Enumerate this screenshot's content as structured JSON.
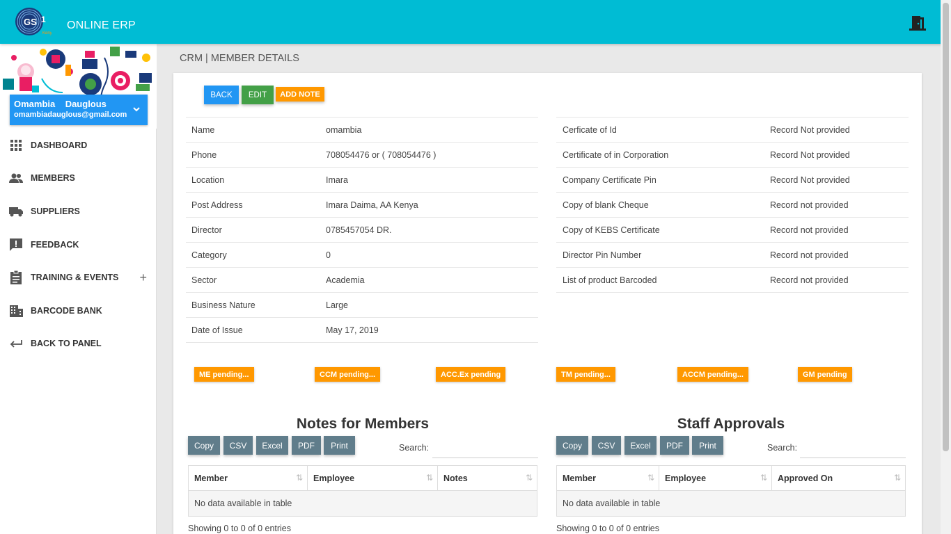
{
  "app": {
    "brand": "ONLINE ERP",
    "logo_text": "GS1",
    "logo_sub": "Kenya"
  },
  "user": {
    "name": "Omambia    Dauglous",
    "email": "omambiadauglous@gmail.com"
  },
  "sidebar": {
    "items": [
      {
        "label": "DASHBOARD",
        "icon": "grid-icon"
      },
      {
        "label": "MEMBERS",
        "icon": "people-icon"
      },
      {
        "label": "SUPPLIERS",
        "icon": "truck-icon"
      },
      {
        "label": "FEEDBACK",
        "icon": "feedback-icon"
      },
      {
        "label": "TRAINING & EVENTS",
        "icon": "clipboard-icon",
        "expand": "+"
      },
      {
        "label": "BARCODE BANK",
        "icon": "building-icon"
      },
      {
        "label": "BACK TO PANEL",
        "icon": "back-arrow-icon"
      }
    ]
  },
  "page": {
    "title": "CRM | MEMBER DETAILS"
  },
  "actions": {
    "back": "BACK",
    "edit": "EDIT",
    "add_note": "ADD NOTE"
  },
  "details_left": [
    {
      "key": "Name",
      "value": "omambia"
    },
    {
      "key": "Phone",
      "value": "708054476 or ( 708054476 )"
    },
    {
      "key": "Location",
      "value": "Imara"
    },
    {
      "key": "Post Address",
      "value": "Imara Daima, AA Kenya"
    },
    {
      "key": "Director",
      "value": "0785457054 DR."
    },
    {
      "key": "Category",
      "value": "0"
    },
    {
      "key": "Sector",
      "value": "Academia"
    },
    {
      "key": "Business Nature",
      "value": "Large"
    },
    {
      "key": "Date of Issue",
      "value": "May 17, 2019"
    }
  ],
  "details_right": [
    {
      "key": "Cerficate of Id",
      "value": "Record Not provided"
    },
    {
      "key": "Certificate of in Corporation",
      "value": "Record Not provided"
    },
    {
      "key": "Company Certificate Pin",
      "value": "Record Not provided"
    },
    {
      "key": "Copy of blank Cheque",
      "value": "Record not provided"
    },
    {
      "key": "Copy of KEBS Certificate",
      "value": "Record not provided"
    },
    {
      "key": "Director Pin Number",
      "value": "Record not provided"
    },
    {
      "key": "List of product Barcoded",
      "value": "Record not provided"
    }
  ],
  "badges": [
    "ME pending...",
    "CCM pending...",
    "ACC.Ex pending",
    "TM pending...",
    "ACCM pending...",
    "GM pending"
  ],
  "export_buttons": [
    "Copy",
    "CSV",
    "Excel",
    "PDF",
    "Print"
  ],
  "search_label": "Search:",
  "notes_table": {
    "title": "Notes for Members",
    "columns": [
      "Member",
      "Employee",
      "Notes"
    ],
    "empty": "No data available in table",
    "info": "Showing 0 to 0 of 0 entries"
  },
  "approvals_table": {
    "title": "Staff Approvals",
    "columns": [
      "Member",
      "Employee",
      "Approved On"
    ],
    "empty": "No data available in table",
    "info": "Showing 0 to 0 of 0 entries"
  },
  "colors": {
    "topbar": "#00bcd4",
    "primary": "#2196f3",
    "success": "#43a047",
    "warning": "#ff9800",
    "export": "#607d8b"
  }
}
